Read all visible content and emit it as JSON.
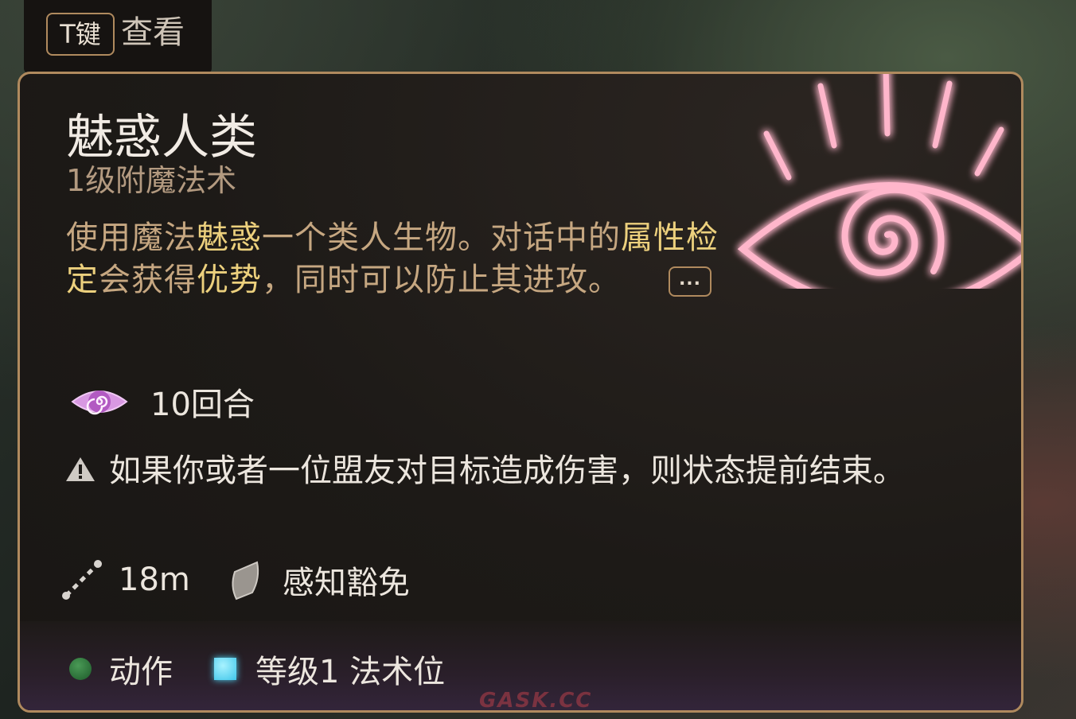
{
  "hint": {
    "key": "T键",
    "label": "查看"
  },
  "spell": {
    "name": "魅惑人类",
    "level_school": "1级附魔法术",
    "description": {
      "p1": "使用魔法",
      "k1": "魅惑",
      "p2": "一个类人生物。对话中的",
      "k2": "属性检定",
      "p3": "会获得",
      "k3": "优势",
      "p4": "，同时可以防止其进攻。"
    },
    "more_label": "...",
    "duration": "10回合",
    "warning": "如果你或者一位盟友对目标造成伤害，则状态提前结束。",
    "range": "18m",
    "save": "感知豁免",
    "cost_action": "动作",
    "cost_slot": "等级1 法术位"
  },
  "icons": {
    "spell_art": "charm-eye-icon",
    "duration": "charm-eye-icon",
    "warning": "warning-icon",
    "range": "range-icon",
    "save": "shield-icon",
    "action": "action-dot-icon",
    "slot": "spell-slot-icon"
  },
  "colors": {
    "border": "#b08a5e",
    "keyword": "#ecd07d",
    "text_warm": "#c6a781",
    "charm_pink": "#ff8fb0",
    "action_green": "#2f7a3e",
    "slot_cyan": "#4fd6f6"
  },
  "watermark": "GASK.CC"
}
